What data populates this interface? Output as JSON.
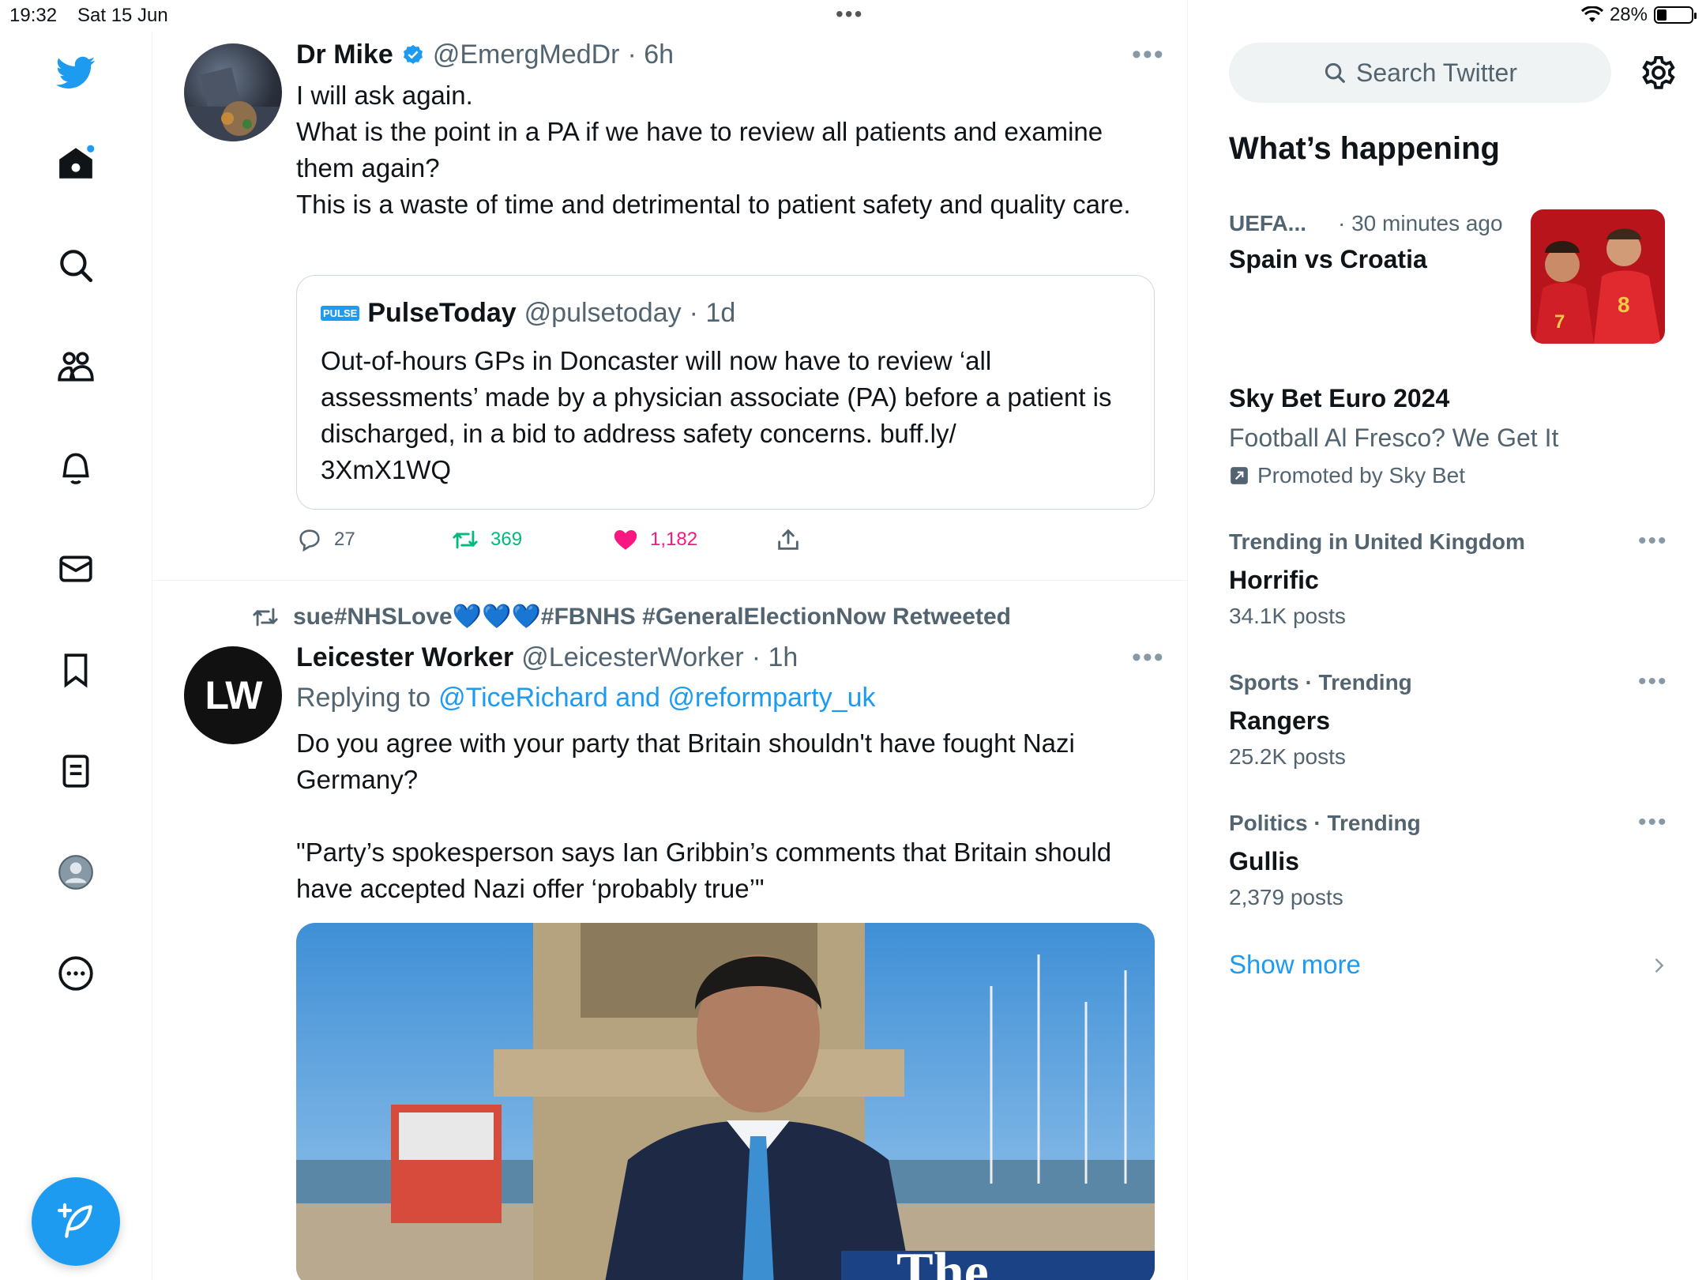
{
  "status_bar": {
    "time": "19:32",
    "date": "Sat 15 Jun",
    "battery": "28%",
    "battery_level": 0.28
  },
  "nav": {
    "items": [
      "twitter-logo",
      "home",
      "explore",
      "communities",
      "notifications",
      "messages",
      "bookmarks",
      "lists",
      "profile",
      "more"
    ]
  },
  "tweets": [
    {
      "name": "Dr Mike",
      "handle": "@EmergMedDr",
      "time": "· 6h",
      "text": "I will ask again.\nWhat is the point in a PA if we have to review all patients and examine them again?\nThis is a waste of time and detrimental to patient safety and quality care.",
      "quote": {
        "logo": "PULSE",
        "name": "PulseToday",
        "handle": "@pulsetoday",
        "time": "· 1d",
        "text": "Out-of-hours GPs in Doncaster will now have to review ‘all assessments’ made by a physician associate (PA) before a patient is discharged, in a bid to address safety concerns. buff.ly/\n3XmX1WQ"
      },
      "replies": "27",
      "retweets": "369",
      "likes": "1,182"
    },
    {
      "retweeted_by": "sue#NHSLove💙💙💙#FBNHS #GeneralElectionNow Retweeted",
      "avatar_text": "LW",
      "name": "Leicester Worker",
      "handle": "@LeicesterWorker",
      "time": "· 1h",
      "replying_prefix": "Replying to",
      "replying_to": "@TiceRichard and @reformparty_uk",
      "text": "Do you agree with your party that Britain shouldn't have fought Nazi Germany?\n\n\"Party’s spokesperson says Ian Gribbin’s comments that Britain should have accepted Nazi offer ‘probably true’\"",
      "media_caption": "The"
    }
  ],
  "sidebar": {
    "search_placeholder": "Search Twitter",
    "heading": "What’s happening",
    "event": {
      "category": "UEFA...",
      "time": "· 30 minutes ago",
      "title": "Spain vs Croatia"
    },
    "promo": {
      "title": "Sky Bet Euro 2024",
      "subtitle": "Football Al Fresco? We Get It",
      "promoted": "Promoted by Sky Bet"
    },
    "trends": [
      {
        "context": "Trending in United Kingdom",
        "title": "Horrific",
        "count": "34.1K posts"
      },
      {
        "context": "Sports · Trending",
        "title": "Rangers",
        "count": "25.2K posts"
      },
      {
        "context": "Politics · Trending",
        "title": "Gullis",
        "count": "2,379 posts"
      }
    ],
    "show_more": "Show more"
  },
  "colors": {
    "accent": "#1d9bf0",
    "retweet": "#00ba7c",
    "like": "#f91880"
  }
}
